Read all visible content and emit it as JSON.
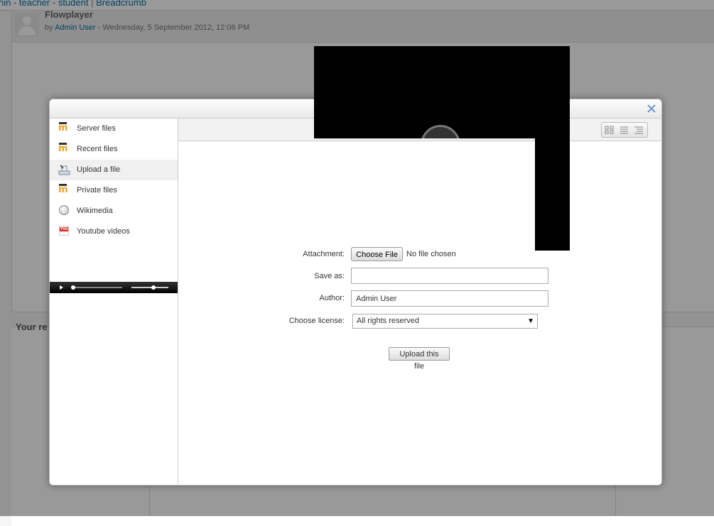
{
  "page": {
    "breadcrumb": [
      "nin - teacher - student",
      "Breadcrumb"
    ],
    "breadcrumb_sep": "|",
    "post_title": "Flowplayer",
    "byline_prefix": "by",
    "author": "Admin User",
    "byline_date": "- Wednesday, 5 September 2012, 12:06 PM",
    "your_re": "Your re"
  },
  "dialog": {
    "repositories": [
      {
        "label": "Server files",
        "icon": "moodle-icon"
      },
      {
        "label": "Recent files",
        "icon": "moodle-icon"
      },
      {
        "label": "Upload a file",
        "icon": "upload-icon",
        "active": true
      },
      {
        "label": "Private files",
        "icon": "moodle-icon"
      },
      {
        "label": "Wikimedia",
        "icon": "wikimedia-icon"
      },
      {
        "label": "Youtube videos",
        "icon": "youtube-icon"
      }
    ],
    "youtube_icon_text": "You",
    "form": {
      "attachment_label": "Attachment:",
      "choose_file": "Choose File",
      "no_file": "No file chosen",
      "save_as_label": "Save as:",
      "save_as_value": "",
      "author_label": "Author:",
      "author_value": "Admin User",
      "license_label": "Choose license:",
      "license_value": "All rights reserved",
      "upload_button": "Upload this file"
    }
  },
  "colors": {
    "link": "#0070a8",
    "moodle_orange": "#f2a21b",
    "close_x": "#5b8ac7"
  }
}
